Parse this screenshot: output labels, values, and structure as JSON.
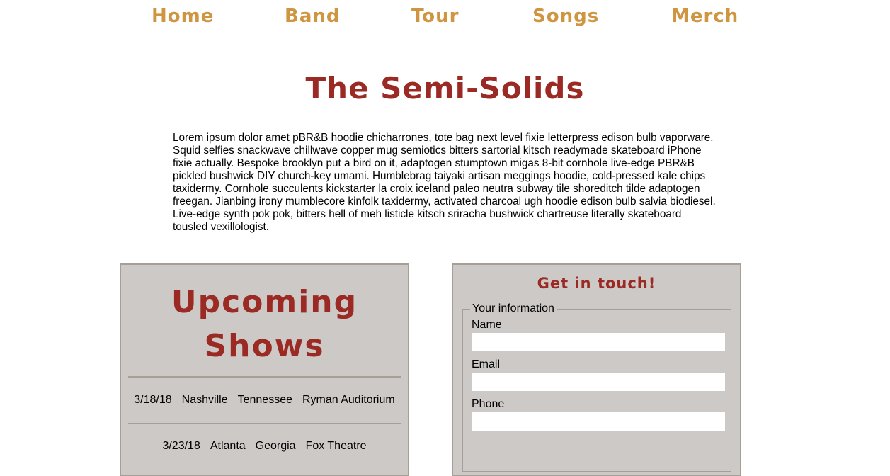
{
  "colors": {
    "nav_accent": "#cf9540",
    "title_red": "#9b2a24",
    "card_bg": "#cdc9c7",
    "card_border": "#a69f98"
  },
  "nav": {
    "items": [
      "Home",
      "Band",
      "Tour",
      "Songs",
      "Merch"
    ]
  },
  "page": {
    "title": "The Semi-Solids",
    "intro": "Lorem ipsum dolor amet pBR&B hoodie chicharrones, tote bag next level fixie letterpress edison bulb vaporware. Squid selfies snackwave chillwave copper mug semiotics bitters sartorial kitsch readymade skateboard iPhone fixie actually. Bespoke brooklyn put a bird on it, adaptogen stumptown migas 8-bit cornhole live-edge PBR&B pickled bushwick DIY church-key umami. Humblebrag taiyaki artisan meggings hoodie, cold-pressed kale chips taxidermy. Cornhole succulents kickstarter la croix iceland paleo neutra subway tile shoreditch tilde adaptogen freegan. Jianbing irony mumblecore kinfolk taxidermy, activated charcoal ugh hoodie edison bulb salvia biodiesel. Live-edge synth pok pok, bitters hell of meh listicle kitsch sriracha bushwick chartreuse literally skateboard tousled vexillologist."
  },
  "shows": {
    "title_line1": "Upcoming",
    "title_line2": "Shows",
    "rows": [
      {
        "date": "3/18/18",
        "city": "Nashville",
        "state": "Tennessee",
        "venue": "Ryman Auditorium"
      },
      {
        "date": "3/23/18",
        "city": "Atlanta",
        "state": "Georgia",
        "venue": "Fox Theatre"
      }
    ]
  },
  "contact": {
    "title": "Get in touch!",
    "legend": "Your information",
    "fields": [
      {
        "label": "Name",
        "value": ""
      },
      {
        "label": "Email",
        "value": ""
      },
      {
        "label": "Phone",
        "value": ""
      }
    ]
  }
}
